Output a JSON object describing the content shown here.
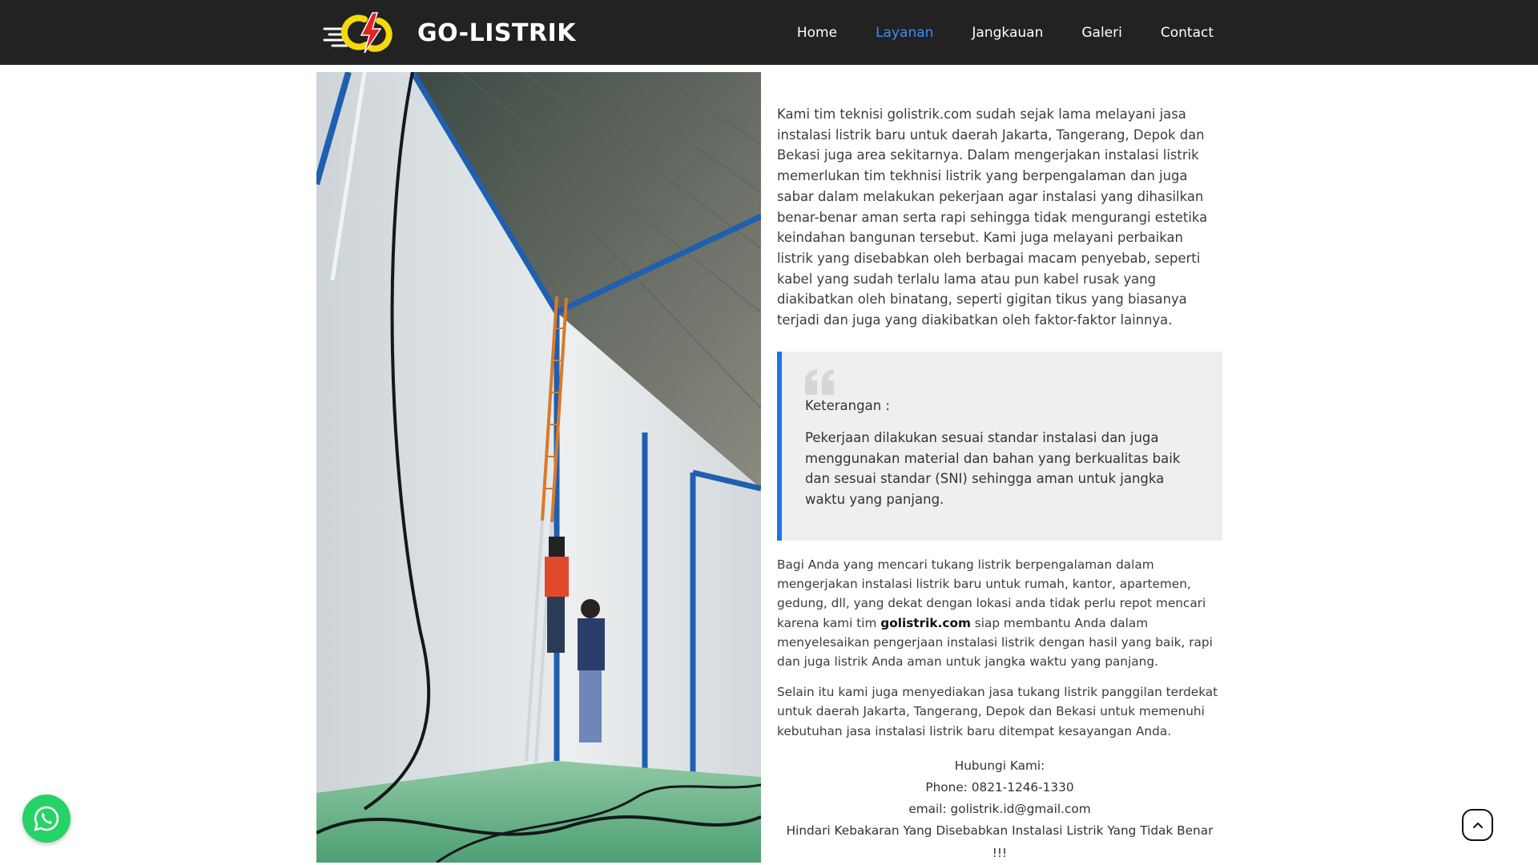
{
  "header": {
    "brand": "GO-LISTRIK",
    "logo_icon": "lightning-bolt-logo",
    "nav": [
      {
        "label": "Home",
        "active": false
      },
      {
        "label": "Layanan",
        "active": true
      },
      {
        "label": "Jangkauan",
        "active": false
      },
      {
        "label": "Galeri",
        "active": false
      },
      {
        "label": "Contact",
        "active": false
      }
    ],
    "colors": {
      "bar": "#222222",
      "active_link": "#3d8df5",
      "logo_yellow": "#f5d90a",
      "logo_red": "#e52421"
    }
  },
  "photo": {
    "icon": "electricians-on-ladder-photo"
  },
  "main": {
    "intro": "Kami tim teknisi golistrik.com sudah sejak lama melayani jasa instalasi listrik baru untuk daerah Jakarta, Tangerang, Depok dan Bekasi juga area sekitarnya. Dalam mengerjakan instalasi listrik memerlukan tim tekhnisi listrik yang berpengalaman dan juga sabar dalam melakukan pekerjaan agar instalasi yang dihasilkan benar-benar aman serta rapi sehingga tidak mengurangi estetika keindahan bangunan tersebut. Kami juga melayani perbaikan listrik yang disebabkan oleh berbagai macam penyebab, seperti kabel yang sudah terlalu lama atau pun kabel rusak yang diakibatkan oleh binatang, seperti gigitan tikus yang biasanya terjadi dan juga yang diakibatkan oleh faktor-faktor lainnya.",
    "quote": {
      "icon": "quote-icon",
      "title": "Keterangan :",
      "text": "Pekerjaan dilakukan sesuai standar instalasi dan juga menggunakan material dan bahan yang berkualitas baik dan sesuai standar (SNI) sehingga aman untuk jangka waktu yang panjang.",
      "accent": "#1e73e8"
    },
    "para2_before": "Bagi Anda yang mencari tukang listrik berpengalaman dalam mengerjakan instalasi listrik baru untuk rumah, kantor, apartemen, gedung, dll, yang dekat dengan lokasi anda tidak perlu repot mencari karena kami tim ",
    "para2_bold": "golistrik.com",
    "para2_after": " siap membantu Anda dalam menyelesaikan pengerjaan instalasi listrik dengan hasil yang baik, rapi dan juga listrik Anda aman untuk jangka waktu yang panjang.",
    "para3": "Selain itu kami juga menyediakan jasa tukang listrik panggilan terdekat untuk daerah Jakarta, Tangerang, Depok dan Bekasi untuk memenuhi kebutuhan jasa instalasi listrik baru ditempat kesayangan Anda.",
    "contact": {
      "heading": "Hubungi Kami:",
      "phone": "Phone: 0821-1246-1330",
      "email": "email: golistrik.id@gmail.com",
      "warning": "Hindari Kebakaran Yang Disebabkan Instalasi Listrik Yang Tidak Benar !!!"
    }
  },
  "floating": {
    "whatsapp_icon": "whatsapp-icon",
    "whatsapp_color": "#25d366",
    "scroll_top_icon": "chevron-up-icon"
  }
}
